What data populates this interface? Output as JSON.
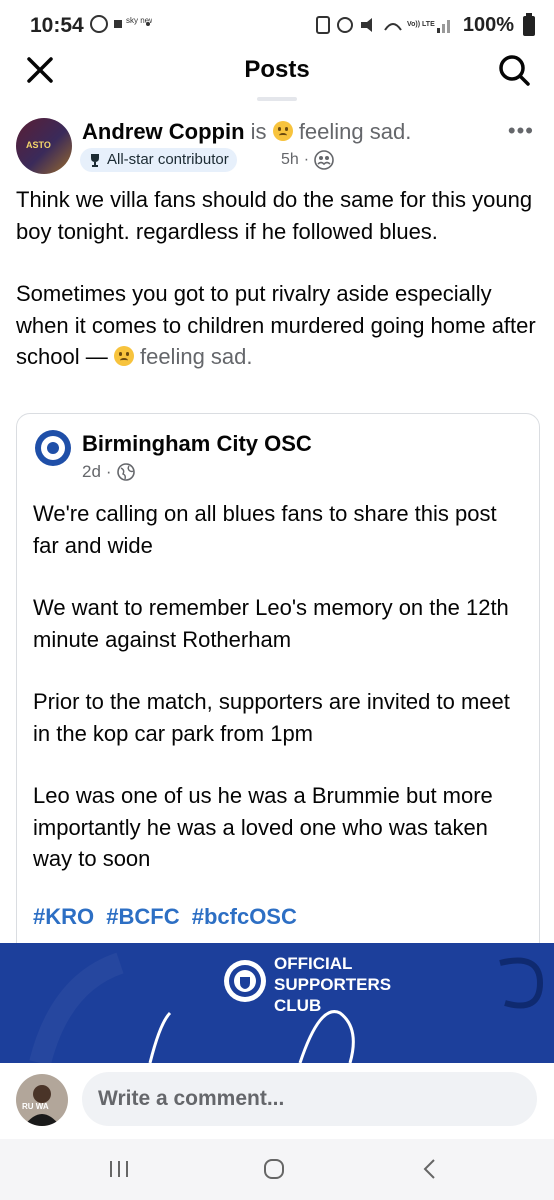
{
  "status_bar": {
    "time": "10:54",
    "battery": "100%",
    "notification_text": "sky news"
  },
  "header": {
    "title": "Posts"
  },
  "post": {
    "author": "Andrew Coppin",
    "is_word": "is",
    "feeling": "feeling sad.",
    "badge": "All-star contributor",
    "time": "5h",
    "avatar_text": "ASTO",
    "body": [
      "Think we villa fans should do the same for this young boy tonight. regardless if he followed blues.",
      "Sometimes you got to put rivalry aside especially when it comes to children murdered going home after school —"
    ],
    "body_feeling": "feeling sad."
  },
  "shared": {
    "page_name": "Birmingham City OSC",
    "time": "2d",
    "paragraphs": [
      "We're calling on all blues fans to share this post far and wide",
      "We want to remember Leo's memory on the 12th minute against Rotherham",
      "Prior to the match, supporters are invited to meet in the kop car park from 1pm",
      "Leo was one of us he was a Brummie but more importantly he was a loved one who was taken way to soon"
    ],
    "hashtags": [
      "#KRO",
      "#BCFC",
      "#bcfcOSC"
    ],
    "banner_lines": [
      "OFFICIAL",
      "SUPPORTERS",
      "CLUB"
    ]
  },
  "comment": {
    "placeholder": "Write a comment...",
    "avatar_text": "RU WA"
  },
  "colors": {
    "link_blue": "#2d6fc4",
    "banner_blue": "#1c3f9b",
    "badge_bg": "#e7f0fb"
  },
  "icons": [
    "close-icon",
    "search-icon",
    "more-icon",
    "trophy-icon",
    "friends-icon",
    "globe-icon",
    "recent-apps-icon",
    "home-icon",
    "back-icon"
  ]
}
